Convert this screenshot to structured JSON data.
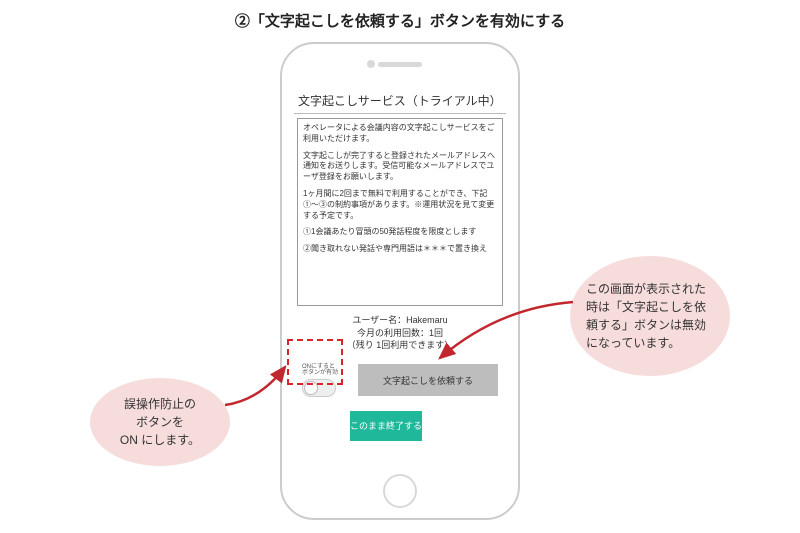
{
  "page": {
    "title": "②「文字起こしを依頼する」ボタンを有効にする"
  },
  "screen": {
    "title": "文字起こしサービス（トライアル中）",
    "info": {
      "p1": "オペレータによる会議内容の文字起こしサービスをご利用いただけます。",
      "p2": "文字起こしが完了すると登録されたメールアドレスへ通知をお送りします。受信可能なメールアドレスでユーザ登録をお願いします。",
      "p3": "1ヶ月間に2回まで無料で利用することができ、下記①〜③の制約事項があります。※運用状況を見て変更する予定です。",
      "p4": "①1会議あたり冒頭の50発話程度を限度とします",
      "p5": "②聞き取れない発話や専門用語は＊＊＊で置き換え"
    },
    "user": {
      "line1": "ユーザー名：Hakemaru",
      "line2": "今月の利用回数：1回",
      "line3": "（残り 1回利用できます）"
    },
    "toggle_label": "ONにすると\nボタンが有効",
    "request_button": "文字起こしを依頼する",
    "finish_button": "このまま終了する"
  },
  "callouts": {
    "left": "誤操作防止の\nボタンを\nON にします。",
    "right": "この画面が表示された時は「文字起こしを依頼する」ボタンは無効になっています。"
  }
}
